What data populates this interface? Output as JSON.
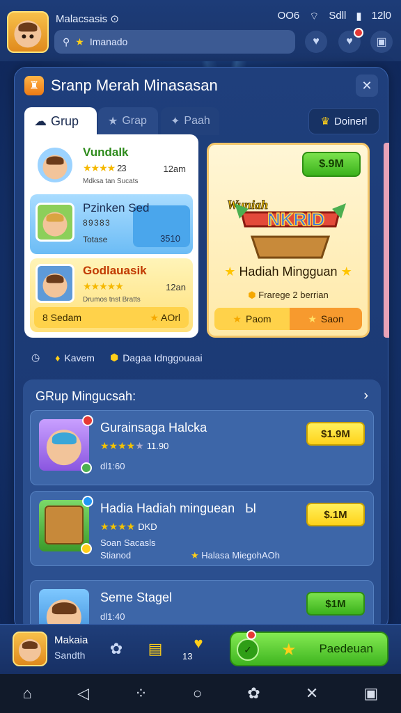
{
  "status": {
    "user_name": "Malacsasis",
    "signal": "◉",
    "net": "Sdll",
    "time": "12l0",
    "misc": "OO6"
  },
  "search": {
    "value": "Imanado"
  },
  "panel": {
    "title": "Sranp Merah Minasasan",
    "tabs": [
      {
        "label": "Grup"
      },
      {
        "label": "Grap"
      },
      {
        "label": "Paah"
      }
    ],
    "donate_label": "Doinerl"
  },
  "members": [
    {
      "name": "Vundalk",
      "rating": "23",
      "value": "12am",
      "sub": "Mdksa tan Sucats"
    },
    {
      "name": "Pzinken Sed",
      "value": "3510",
      "sub": "Totase",
      "code": "8 9 3 8 3"
    },
    {
      "name": "Godlauasik",
      "value": "12an",
      "sub": "Drumos tnst Bratts",
      "bar_left": "8 Sedam",
      "bar_right": "AOrl"
    }
  ],
  "prize": {
    "price": "$.9M",
    "art_label": "Wuniah",
    "art_word": "NKRID",
    "title": "Hadiah Mingguan",
    "sub": "Frarege 2 berrian",
    "bar_left": "Paom",
    "bar_right": "Saon"
  },
  "info": {
    "item1": "Kavem",
    "item2": "Dagaa Idnggouaai"
  },
  "section": {
    "title": "GRup Mingucsah:",
    "rows": [
      {
        "title": "Gurainsaga Halcka",
        "rating_text": "11.90",
        "sub1": "dl1:60",
        "sub2": "",
        "price": "$1.9M"
      },
      {
        "title": "Hadia Hadiah minguean",
        "extra": "Ы",
        "rating_text": "DKD",
        "sub1": "Soan Sacasls",
        "sub2": "Stianod",
        "sub3": "Halasa MiegohAOh",
        "price": "$.1M"
      },
      {
        "title": "Seme Stagel",
        "rating_text": "",
        "sub1": "dl1:40",
        "sub2": "",
        "price": "$1M"
      }
    ]
  },
  "bottom": {
    "name": "Makaia",
    "sub": "Sandth",
    "score": "13",
    "play_label": "Paedeuan",
    "chip_count": "0"
  },
  "colors": {
    "accent_green": "#3bb21c",
    "accent_yellow": "#ffd21a",
    "panel_bg": "#1f3f7c"
  }
}
